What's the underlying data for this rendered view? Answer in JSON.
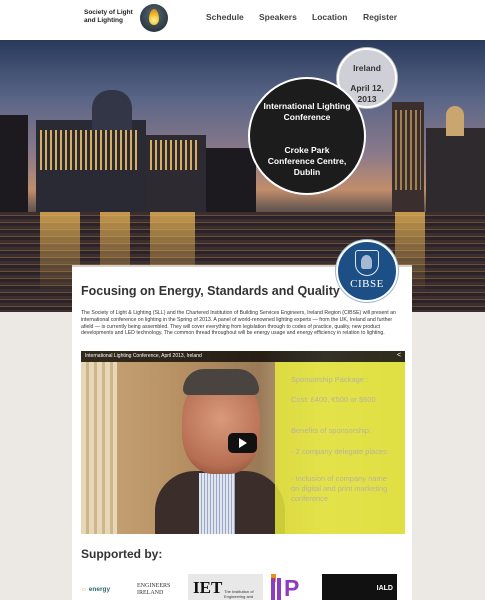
{
  "header": {
    "logo_line1": "Society of Light",
    "logo_line2": "and Lighting",
    "nav": [
      "Schedule",
      "Speakers",
      "Location",
      "Register"
    ]
  },
  "hero": {
    "country": "Ireland",
    "date_line1": "April 12,",
    "date_line2": "2013",
    "event_line1": "International Lighting",
    "event_line2": "Conference",
    "venue_line1": "Croke Park",
    "venue_line2": "Conference Centre,",
    "venue_line3": "Dublin"
  },
  "cibse_logo": "CIBSE",
  "main": {
    "title": "Focusing on Energy, Standards and Quality",
    "intro": "The Society of Light & Lighting (SLL) and the Chartered Institution of Building Services Engineers, Ireland Region (CIBSE) will present an international conference on lighting in the Spring of 2013. A panel of world-renowned lighting experts — from the UK, Ireland and further afield — is currently being assembled. They will cover everything from legislation through to codes of practice, quality, new product developments and LED technology. The common thread throughout will be energy usage and energy efficiency in relation to lighting."
  },
  "video": {
    "title": "International Lighting Conference, April 2013, Ireland",
    "share_icon": "share-icon",
    "sponsor_heading": "Sponsorship Package :",
    "cost": "Cost: £400, €500 or $600",
    "benefits_heading": "Benefits of sponsorship:",
    "benefit1": "- 2 company delegate places",
    "benefit2": "- Inclusion of company name on digital and print marketing conference"
  },
  "supporters": {
    "heading": "Supported by:",
    "energy": "energy",
    "engineers_line1": "ENGINEERS",
    "engineers_line2": "IRELAND",
    "iet": "IET",
    "iet_sub": "The Institution of Engineering and Technology",
    "ilp": "P",
    "iald": "IALD"
  }
}
